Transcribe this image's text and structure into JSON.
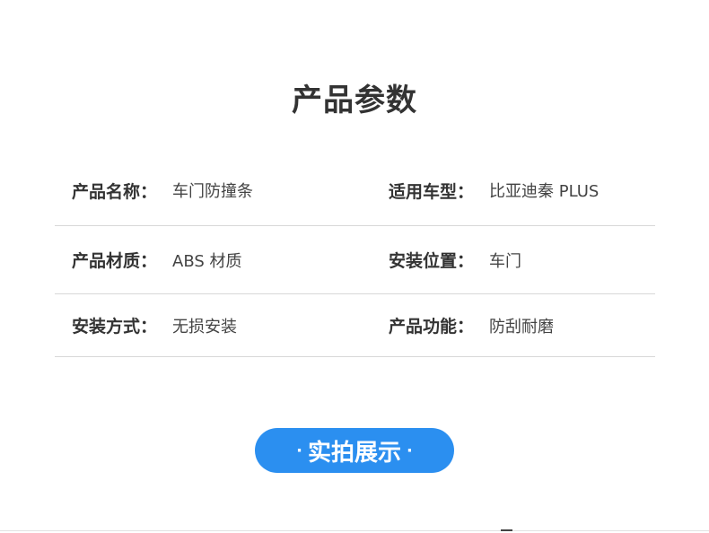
{
  "title": "产品参数",
  "params": [
    {
      "left": {
        "label": "产品名称：",
        "value": "车门防撞条"
      },
      "right": {
        "label": "适用车型：",
        "value": "比亚迪秦 PLUS"
      }
    },
    {
      "left": {
        "label": "产品材质：",
        "value": "ABS 材质"
      },
      "right": {
        "label": "安装位置：",
        "value": "车门"
      }
    },
    {
      "left": {
        "label": "安装方式：",
        "value": "无损安装"
      },
      "right": {
        "label": "产品功能：",
        "value": "防刮耐磨"
      }
    }
  ],
  "button": {
    "dot": "·",
    "text": "实拍展示"
  },
  "colors": {
    "accent": "#2b8ff0",
    "text": "#333333",
    "divider": "#d8d8d8"
  }
}
